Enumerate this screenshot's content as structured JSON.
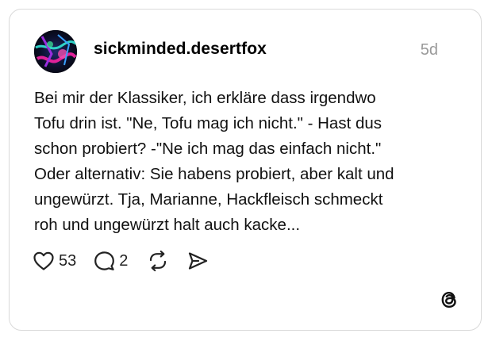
{
  "post": {
    "author": {
      "username": "sickminded.desertfox",
      "avatar_icon": "avatar-image"
    },
    "timestamp": "5d",
    "text_lines": [
      "Bei mir der Klassiker, ich erkläre dass irgendwo",
      "Tofu drin ist. \"Ne, Tofu mag ich nicht.\" - Hast dus",
      "schon probiert? -\"Ne ich mag das einfach nicht.\"",
      "Oder alternativ: Sie habens probiert, aber kalt und",
      "ungewürzt. Tja, Marianne, Hackfleisch schmeckt",
      "roh und ungewürzt halt auch kacke..."
    ],
    "actions": {
      "likes": "53",
      "replies": "2",
      "like_icon": "heart-icon",
      "reply_icon": "speech-bubble-icon",
      "repost_icon": "repost-icon",
      "share_icon": "send-icon"
    },
    "brand_icon": "threads-logo-icon"
  },
  "colors": {
    "border": "#d9d9d9",
    "muted_text": "#999999",
    "text": "#111111"
  }
}
